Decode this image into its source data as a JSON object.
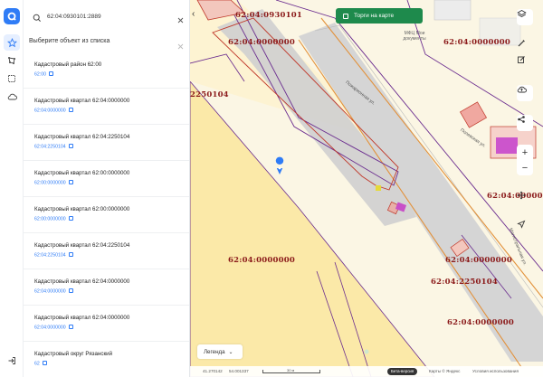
{
  "search": {
    "value": "62:04:0930101:2889"
  },
  "list": {
    "heading": "Выберите объект из списка",
    "items": [
      {
        "title": "Кадастровый район 62:00",
        "number": "62:00"
      },
      {
        "title": "Кадастровый квартал 62:04:0000000",
        "number": "62:04:0000000"
      },
      {
        "title": "Кадастровый квартал 62:04:2250104",
        "number": "62:04:2250104"
      },
      {
        "title": "Кадастровый квартал 62:00:0000000",
        "number": "62:00:0000000"
      },
      {
        "title": "Кадастровый квартал 62:00:0000000",
        "number": "62:00:0000000"
      },
      {
        "title": "Кадастровый квартал 62:04:2250104",
        "number": "62:04:2250104"
      },
      {
        "title": "Кадастровый квартал 62:04:0000000",
        "number": "62:04:0000000"
      },
      {
        "title": "Кадастровый квартал 62:04:0000000",
        "number": "62:04:0000000"
      },
      {
        "title": "Кадастровый округ Рязанский",
        "number": "62"
      }
    ]
  },
  "map": {
    "torgi_label": "Торги на карте",
    "legend_label": "Легенда",
    "legend_chevron": "⌄",
    "cadastral_labels": [
      "62:04:0930101",
      "62:04:0000000",
      "62:04:0000000",
      "2250104",
      "62:04:0000000",
      "62:04:0000000",
      "62:04:0000000",
      "62:04:2250104",
      "62:04:0000000"
    ],
    "street_labels": [
      "Пожарионная ул.",
      "Полевская ул.",
      "Магистральная ул."
    ],
    "mfc_label": "МФЦ Мои документы",
    "status": {
      "coords_lat": "41.270142",
      "coords_lon": "54.001337",
      "scale": "30 м",
      "beta": "Бета-версия",
      "maps_provider": "Карты © Яндекс",
      "terms": "Условия использования"
    }
  },
  "colors": {
    "accent": "#2f7cf6",
    "torgi_green": "#1e8a4c",
    "cadastral_red": "#8b1a1a",
    "parcel_purple": "#6b2d8f",
    "parcel_fill": "#fbe9a8"
  },
  "icons": {
    "rail": [
      "app-logo-icon",
      "star-icon",
      "polygon-icon",
      "rectangle-select-icon",
      "cloud-icon",
      "logout-icon"
    ],
    "tools": [
      "layers-icon",
      "ruler-icon",
      "edit-icon",
      "upload-cloud-icon",
      "share-icon",
      "move-icon",
      "navigate-icon"
    ]
  }
}
